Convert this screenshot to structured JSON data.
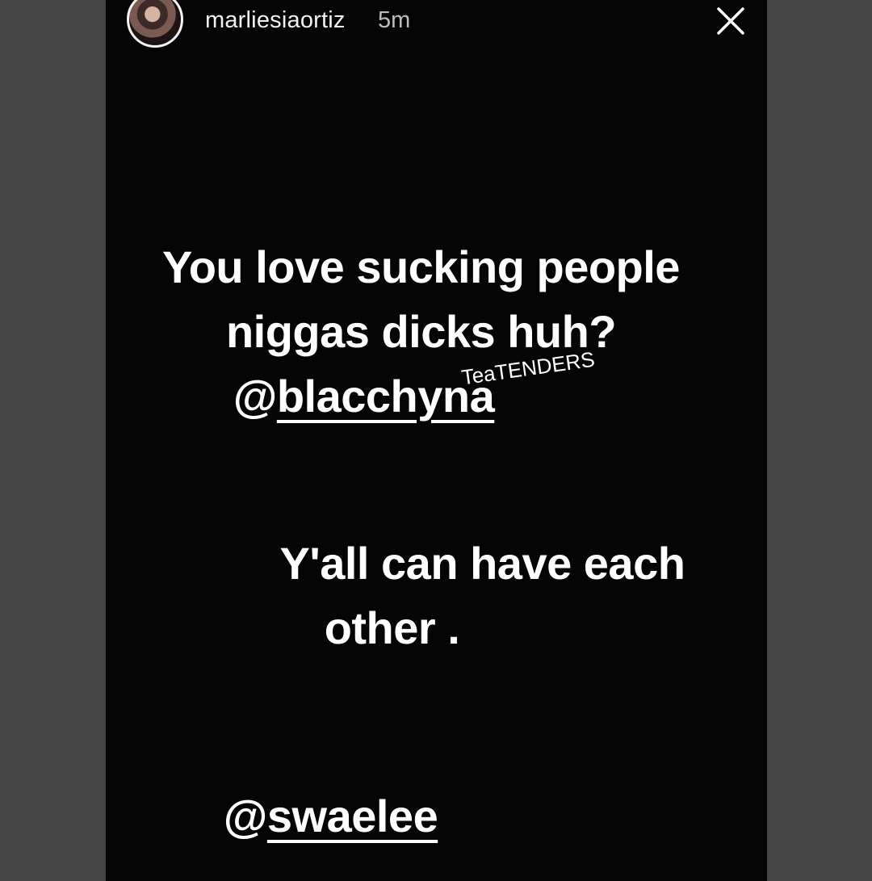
{
  "header": {
    "username": "marliesiaortiz",
    "time": "5m"
  },
  "icons": {
    "close": "close-icon",
    "avatar": "avatar"
  },
  "story": {
    "line1": "You love sucking people",
    "line2": "niggas dicks huh?",
    "mention1_prefix": "@",
    "mention1_handle": "blacchyna",
    "watermark": "TeaTENDERS",
    "line3": "Y'all can have each",
    "line4": "other .",
    "mention2_prefix": "@",
    "mention2_handle": "swaelee"
  },
  "colors": {
    "background": "#050505",
    "outer": "#444444",
    "text": "#ffffff",
    "time": "#bdbdbd"
  }
}
